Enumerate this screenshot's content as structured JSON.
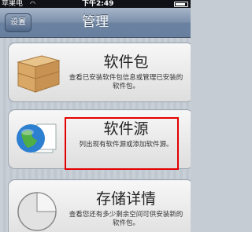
{
  "status_bar": {
    "carrier": "苹果电",
    "time": "下午2:49"
  },
  "nav": {
    "back_label": "设置",
    "title": "管理"
  },
  "cards": [
    {
      "title": "软件包",
      "desc": "查看已安装软件包信息或管理已安装的软件包。",
      "icon": "package-box-icon"
    },
    {
      "title": "软件源",
      "desc": "列出现有软件源或添加软件源。",
      "icon": "globe-source-icon"
    },
    {
      "title": "存储详情",
      "desc": "查看您还有多少剩余空间可供安装新的软件包。",
      "icon": "storage-pie-icon"
    }
  ],
  "colors": {
    "nav_bar": "#6f85a3",
    "highlight": "#e30000"
  }
}
